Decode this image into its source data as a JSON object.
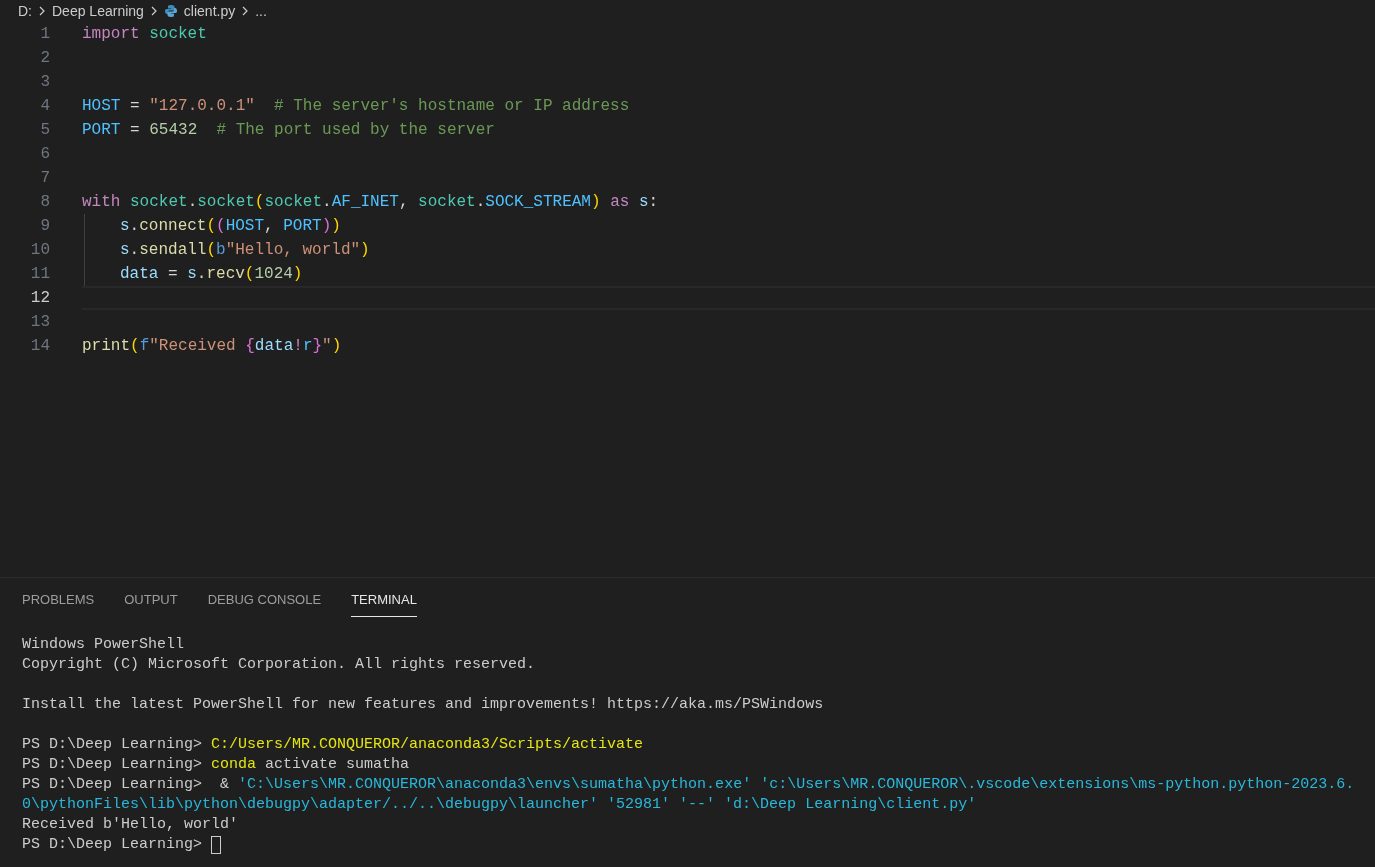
{
  "breadcrumb": [
    {
      "text": "D:",
      "kind": "folder"
    },
    {
      "text": "Deep Learning",
      "kind": "folder"
    },
    {
      "text": "client.py",
      "kind": "python-file"
    },
    {
      "text": "...",
      "kind": "more"
    }
  ],
  "editor": {
    "lines": [
      {
        "number": "1",
        "current": false,
        "indent": false,
        "tokens": [
          {
            "text": "import",
            "kind": "keyword"
          },
          {
            "text": " socket",
            "kind": "module"
          }
        ]
      },
      {
        "number": "2",
        "current": false,
        "indent": false
      },
      {
        "number": "3",
        "current": false,
        "indent": false
      },
      {
        "number": "4",
        "current": false,
        "indent": false,
        "tokens": [
          {
            "text": "HOST",
            "kind": "constant"
          },
          {
            "text": " = "
          },
          {
            "text": "\"127.0.0.1\"",
            "kind": "string"
          },
          {
            "text": "  # The server's hostname or IP address",
            "kind": "comment"
          }
        ]
      },
      {
        "number": "5",
        "current": false,
        "indent": false,
        "tokens": [
          {
            "text": "PORT",
            "kind": "constant"
          },
          {
            "text": " = "
          },
          {
            "text": "65432",
            "kind": "number"
          },
          {
            "text": "  # The port used by the server",
            "kind": "comment"
          }
        ]
      },
      {
        "number": "6",
        "current": false,
        "indent": false
      },
      {
        "number": "7",
        "current": false,
        "indent": false
      },
      {
        "number": "8",
        "current": false,
        "indent": false,
        "tokens": [
          {
            "text": "with",
            "kind": "keyword"
          },
          {
            "text": " socket",
            "kind": "module"
          },
          {
            "text": "."
          },
          {
            "text": "socket",
            "kind": "module"
          },
          {
            "text": "(",
            "kind": "bracket1"
          },
          {
            "text": "socket",
            "kind": "module"
          },
          {
            "text": "."
          },
          {
            "text": "AF_INET",
            "kind": "constant"
          },
          {
            "text": ", "
          },
          {
            "text": "socket",
            "kind": "module"
          },
          {
            "text": "."
          },
          {
            "text": "SOCK_STREAM",
            "kind": "constant"
          },
          {
            "text": ")",
            "kind": "bracket1"
          },
          {
            "text": " as",
            "kind": "keyword"
          },
          {
            "text": " s",
            "kind": "variable"
          },
          {
            "text": ":"
          }
        ]
      },
      {
        "number": "9",
        "current": false,
        "indent": true,
        "tokens": [
          {
            "text": "s",
            "kind": "variable"
          },
          {
            "text": "."
          },
          {
            "text": "connect",
            "kind": "function"
          },
          {
            "text": "(",
            "kind": "bracket1"
          },
          {
            "text": "(",
            "kind": "bracket2"
          },
          {
            "text": "HOST",
            "kind": "constant"
          },
          {
            "text": ", "
          },
          {
            "text": "PORT",
            "kind": "constant"
          },
          {
            "text": ")",
            "kind": "bracket2"
          },
          {
            "text": ")",
            "kind": "bracket1"
          }
        ]
      },
      {
        "number": "10",
        "current": false,
        "indent": true,
        "tokens": [
          {
            "text": "s",
            "kind": "variable"
          },
          {
            "text": "."
          },
          {
            "text": "sendall",
            "kind": "function"
          },
          {
            "text": "(",
            "kind": "bracket1"
          },
          {
            "text": "b",
            "kind": "storage"
          },
          {
            "text": "\"Hello, world\"",
            "kind": "string"
          },
          {
            "text": ")",
            "kind": "bracket1"
          }
        ]
      },
      {
        "number": "11",
        "current": false,
        "indent": true,
        "tokens": [
          {
            "text": "data",
            "kind": "variable"
          },
          {
            "text": " = "
          },
          {
            "text": "s",
            "kind": "variable"
          },
          {
            "text": "."
          },
          {
            "text": "recv",
            "kind": "function"
          },
          {
            "text": "(",
            "kind": "bracket1"
          },
          {
            "text": "1024",
            "kind": "number"
          },
          {
            "text": ")",
            "kind": "bracket1"
          }
        ]
      },
      {
        "number": "12",
        "current": true,
        "indent": false
      },
      {
        "number": "13",
        "current": false,
        "indent": false
      },
      {
        "number": "14",
        "current": false,
        "indent": false,
        "tokens": [
          {
            "text": "print",
            "kind": "function"
          },
          {
            "text": "(",
            "kind": "bracket1"
          },
          {
            "text": "f",
            "kind": "storage"
          },
          {
            "text": "\"Received ",
            "kind": "string"
          },
          {
            "text": "{",
            "kind": "bracket2"
          },
          {
            "text": "data",
            "kind": "variable"
          },
          {
            "text": "!",
            "kind": "keyword"
          },
          {
            "text": "r",
            "kind": "constant"
          },
          {
            "text": "}",
            "kind": "bracket2"
          },
          {
            "text": "\"",
            "kind": "string"
          },
          {
            "text": ")",
            "kind": "bracket1"
          }
        ]
      }
    ]
  },
  "panel_tabs": [
    {
      "label": "PROBLEMS",
      "selected": false
    },
    {
      "label": "OUTPUT",
      "selected": false
    },
    {
      "label": "DEBUG CONSOLE",
      "selected": false
    },
    {
      "label": "TERMINAL",
      "selected": true
    }
  ],
  "terminal": {
    "blocks": [
      {
        "lines": [
          {
            "segments": [
              {
                "text": "Windows PowerShell"
              }
            ]
          },
          {
            "segments": [
              {
                "text": "Copyright (C) Microsoft Corporation. All rights reserved."
              }
            ]
          }
        ]
      },
      {
        "lines": [
          {
            "segments": [
              {
                "text": "Install the latest PowerShell for new features and improvements! https://aka.ms/PSWindows"
              }
            ]
          }
        ]
      },
      {
        "lines": [
          {
            "segments": [
              {
                "text": "PS D:\\Deep Learning> "
              },
              {
                "text": "C:/Users/MR.CONQUEROR/anaconda3/Scripts/activate",
                "kind": "command"
              }
            ]
          },
          {
            "segments": [
              {
                "text": "PS D:\\Deep Learning> "
              },
              {
                "text": "conda",
                "kind": "command"
              },
              {
                "text": " activate sumatha"
              }
            ]
          },
          {
            "segments": [
              {
                "text": "PS D:\\Deep Learning>  & "
              },
              {
                "text": "'C:\\Users\\MR.CONQUEROR\\anaconda3\\envs\\sumatha\\python.exe' 'c:\\Users\\MR.CONQUEROR\\.vscode\\extensions\\ms-python.python-2023.6.",
                "kind": "argument"
              }
            ]
          },
          {
            "segments": [
              {
                "text": "0\\pythonFiles\\lib\\python\\debugpy\\adapter/../..\\debugpy\\launcher' '52981' '--' 'd:\\Deep Learning\\client.py'",
                "kind": "argument"
              }
            ]
          },
          {
            "segments": [
              {
                "text": "Received b'Hello, world'"
              }
            ]
          },
          {
            "segments": [
              {
                "text": "PS D:\\Deep Learning> "
              }
            ],
            "cursor": true
          }
        ]
      }
    ]
  }
}
